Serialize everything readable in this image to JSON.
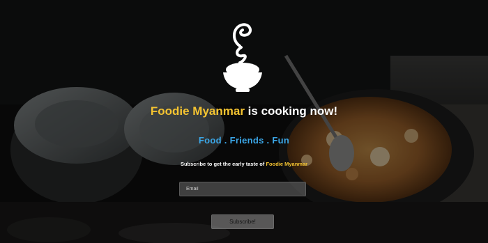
{
  "logo": {
    "icon": "steaming-rice-bowl-icon"
  },
  "headline": {
    "brand": "Foodie Myanmar",
    "rest": " is cooking now!"
  },
  "tagline": "Food . Friends . Fun",
  "subscribe": {
    "text_prefix": "Subscribe to get the early taste of ",
    "brand": "Foodie Myanmar",
    "email_placeholder": "Email",
    "button_label": "Subscribe!"
  },
  "colors": {
    "brand": "#f5c431",
    "tagline": "#3ba7e8",
    "background": "#0b0b0b"
  }
}
